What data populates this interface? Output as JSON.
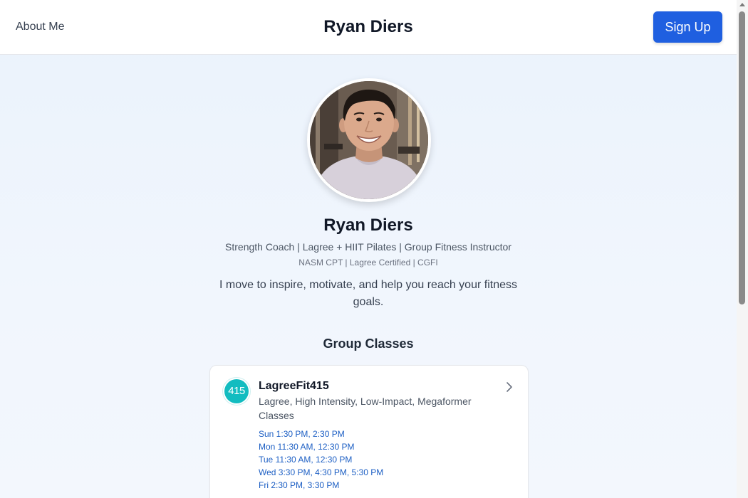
{
  "header": {
    "nav_label": "About Me",
    "title": "Ryan Diers",
    "signup_label": "Sign Up"
  },
  "profile": {
    "name": "Ryan Diers",
    "tagline": "Strength Coach | Lagree + HIIT Pilates | Group Fitness Instructor",
    "certifications": "NASM CPT | Lagree Certified | CGFI",
    "bio": "I move to inspire, motivate, and help you reach your fitness goals."
  },
  "group_classes": {
    "heading": "Group Classes",
    "items": [
      {
        "logo_text": "415",
        "name": "LagreeFit415",
        "tags": "Lagree, High Intensity, Low-Impact, Megaformer Classes",
        "schedule": [
          "Sun 1:30 PM, 2:30 PM",
          "Mon 11:30 AM, 12:30 PM",
          "Tue 11:30 AM, 12:30 PM",
          "Wed 3:30 PM, 4:30 PM, 5:30 PM",
          "Fri 2:30 PM, 3:30 PM"
        ]
      }
    ]
  },
  "icons": {
    "card_chevron": "chevron-right-icon",
    "scroll_up": "arrow-up-icon"
  },
  "colors": {
    "accent": "#1f5fe0",
    "schedule_link": "#1d5fc4",
    "studio_logo": "#12bcc0",
    "page_background": "#eaf2fc"
  }
}
